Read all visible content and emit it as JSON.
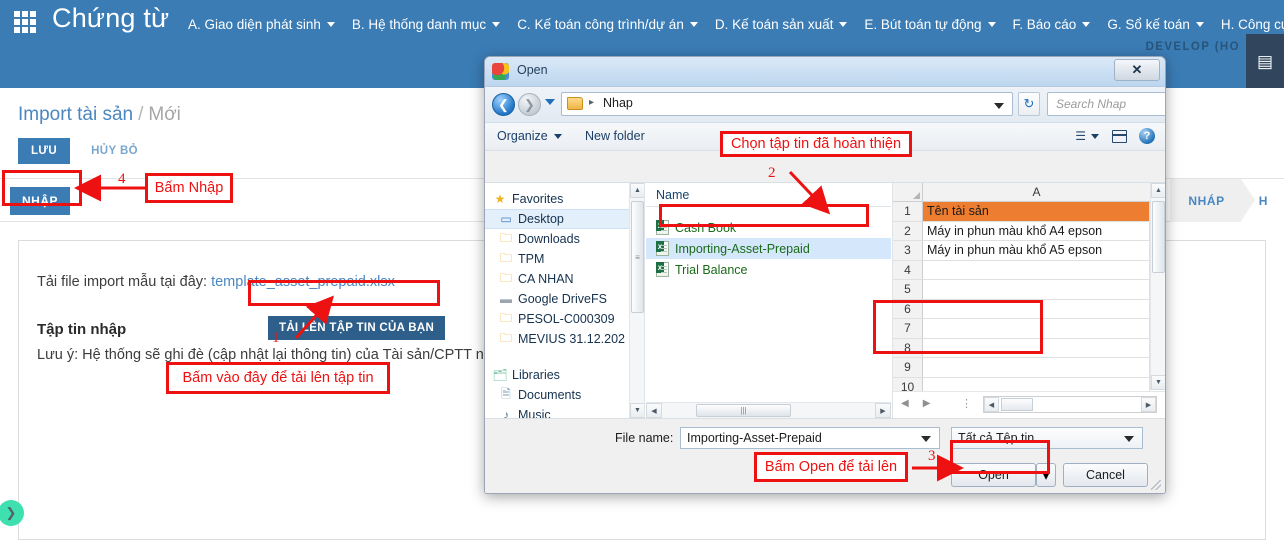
{
  "header": {
    "title": "Chứng từ",
    "grid_icon": "app-grid-icon",
    "menus": [
      {
        "label": "A. Giao diện phát sinh"
      },
      {
        "label": "B. Hệ thống danh mục"
      },
      {
        "label": "C. Kế toán công trình/dự án"
      },
      {
        "label": "D. Kế toán sản xuất"
      },
      {
        "label": "E. Bút toán tự động"
      },
      {
        "label": "F. Báo cáo"
      },
      {
        "label": "G. Sổ kế toán"
      },
      {
        "label": "H. Công cụ tiện ích"
      }
    ],
    "env_label": "DEVELOP (HO",
    "help_icon": "book-icon",
    "accent_color": "#3b7cb5"
  },
  "page": {
    "breadcrumb_main": "Import tài sản",
    "breadcrumb_sep": "/",
    "breadcrumb_sub": "Mới",
    "save_label": "LƯU",
    "cancel_label": "HỦY BỎ",
    "import_label": "NHẬP",
    "chips": [
      {
        "label": "NHÁP"
      },
      {
        "label": "H"
      }
    ],
    "card": {
      "template_text": "Tải file import mẫu tại đây:",
      "template_link": "template_asset_prepaid.xlsx",
      "field_label": "Tập tin nhập",
      "upload_button": "TẢI LÊN TẬP TIN CỦA BẠN",
      "note": "Lưu ý: Hệ thống sẽ ghi đè (cập nhật lại thông tin) của Tài sản/CPTT n"
    },
    "toggle_icon": "chevron-right-icon"
  },
  "dialog": {
    "title": "Open",
    "title_icon": "chrome-icon",
    "close_label": "✕",
    "address": {
      "back_icon": "back-arrow-icon",
      "forward_icon": "forward-arrow-icon",
      "recent_icon": "recent-dropdown-icon",
      "folder_icon": "folder-icon",
      "path_separator": "▸",
      "path": "Nhap",
      "dropdown_icon": "chevron-down-icon",
      "refresh_icon": "refresh-icon",
      "search_placeholder": "Search Nhap",
      "search_icon": "search-icon"
    },
    "toolbar": {
      "organize": "Organize",
      "new_folder": "New folder",
      "views_icon": "view-list-icon",
      "preview_pane_icon": "preview-pane-icon",
      "help_icon": "help-icon"
    },
    "nav_pane": {
      "sections": [
        {
          "icon": "star-icon",
          "label": "Favorites",
          "type": "head"
        },
        {
          "icon": "monitor-icon",
          "label": "Desktop",
          "type": "item",
          "selected": true
        },
        {
          "icon": "download-folder-icon",
          "label": "Downloads",
          "type": "item"
        },
        {
          "icon": "folder-icon",
          "label": "TPM",
          "type": "item"
        },
        {
          "icon": "folder-icon",
          "label": "CA NHAN",
          "type": "item"
        },
        {
          "icon": "drive-icon",
          "label": "Google DriveFS",
          "type": "item"
        },
        {
          "icon": "folder-icon",
          "label": "PESOL-C000309",
          "type": "item"
        },
        {
          "icon": "folder-icon",
          "label": "MEVIUS 31.12.202",
          "type": "item"
        },
        {
          "icon": "libraries-icon",
          "label": "Libraries",
          "type": "head"
        },
        {
          "icon": "document-icon",
          "label": "Documents",
          "type": "item"
        },
        {
          "icon": "music-icon",
          "label": "Music",
          "type": "item"
        }
      ],
      "scroll_up_icon": "scroll-up-icon",
      "scroll_down_icon": "scroll-down-icon"
    },
    "file_pane": {
      "column_header": "Name",
      "files": [
        {
          "name": "Cash Book",
          "icon": "excel-file-icon",
          "selected": false
        },
        {
          "name": "Importing-Asset-Prepaid",
          "icon": "excel-file-icon",
          "selected": true
        },
        {
          "name": "Trial Balance",
          "icon": "excel-file-icon",
          "selected": false
        }
      ],
      "hscroll_left_icon": "scroll-left-icon",
      "hscroll_right_icon": "scroll-right-icon"
    },
    "preview": {
      "column_header": "A",
      "rows": [
        {
          "num": "1",
          "value": "Tên tài sản",
          "header_cell": true
        },
        {
          "num": "2",
          "value": "Máy in phun màu khổ A4 epson",
          "header_cell": false
        },
        {
          "num": "3",
          "value": "Máy in phun màu khổ A5 epson",
          "header_cell": false
        },
        {
          "num": "4",
          "value": "",
          "header_cell": false
        },
        {
          "num": "5",
          "value": "",
          "header_cell": false
        },
        {
          "num": "6",
          "value": "",
          "header_cell": false
        },
        {
          "num": "7",
          "value": "",
          "header_cell": false
        },
        {
          "num": "8",
          "value": "",
          "header_cell": false
        },
        {
          "num": "9",
          "value": "",
          "header_cell": false
        },
        {
          "num": "10",
          "value": "",
          "header_cell": false
        }
      ],
      "header_fill": "#ed7d31",
      "sheet_prev_icon": "sheet-prev-icon",
      "sheet_next_icon": "sheet-next-icon"
    },
    "footer": {
      "filename_label": "File name:",
      "filename_value": "Importing-Asset-Prepaid",
      "filetype_value": "Tất cả Tệp tin",
      "open_label": "Open",
      "open_split_icon": "chevron-down-icon",
      "cancel_label": "Cancel"
    }
  },
  "annotations": {
    "color": "#ee1111",
    "items": [
      {
        "number": "1",
        "text": "Bấm vào đây để tải lên tập tin"
      },
      {
        "number": "2",
        "text": "Chọn tập tin đã hoàn thiện"
      },
      {
        "number": "3",
        "text": "Bấm Open để tải lên"
      },
      {
        "number": "4",
        "text": "Bấm Nhập"
      }
    ]
  }
}
